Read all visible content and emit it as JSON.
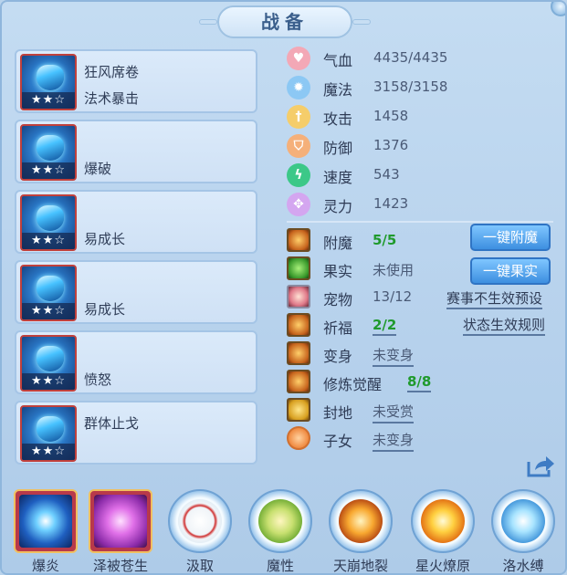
{
  "title": "战备",
  "equipment": [
    {
      "name": "狂风席卷",
      "effect": "法术暴击",
      "stars": "★★☆"
    },
    {
      "name": "",
      "effect": "爆破",
      "stars": "★★☆"
    },
    {
      "name": "",
      "effect": "易成长",
      "stars": "★★☆"
    },
    {
      "name": "",
      "effect": "易成长",
      "stars": "★★☆"
    },
    {
      "name": "",
      "effect": "愤怒",
      "stars": "★★☆"
    },
    {
      "name": "群体止戈",
      "effect": "",
      "stars": "★★☆"
    }
  ],
  "stats": [
    {
      "label": "气血",
      "value": "4435/4435",
      "icon": "heart-icon",
      "color": "#e8647c"
    },
    {
      "label": "魔法",
      "value": "3158/3158",
      "icon": "mana-icon",
      "color": "#4aa8f0"
    },
    {
      "label": "攻击",
      "value": "1458",
      "icon": "sword-icon",
      "color": "#f0b040"
    },
    {
      "label": "防御",
      "value": "1376",
      "icon": "shield-icon",
      "color": "#f0a060"
    },
    {
      "label": "速度",
      "value": "543",
      "icon": "lightning-icon",
      "color": "#28c07a"
    },
    {
      "label": "灵力",
      "value": "1423",
      "icon": "spirit-icon",
      "color": "#c080e8"
    }
  ],
  "info": [
    {
      "label": "附魔",
      "value": "5/5"
    },
    {
      "label": "果实",
      "value": "未使用"
    },
    {
      "label": "宠物",
      "value": "13/12"
    },
    {
      "label": "祈福",
      "value": "2/2"
    },
    {
      "label": "变身",
      "value": "未变身"
    },
    {
      "label": "修炼觉醒",
      "value": "8/8"
    },
    {
      "label": "封地",
      "value": "未受赏"
    },
    {
      "label": "子女",
      "value": "未变身"
    }
  ],
  "buttons": {
    "enchant": "一键附魔",
    "fruit": "一键果实"
  },
  "links": {
    "event_preset": "赛事不生效预设",
    "status_rules": "状态生效规则"
  },
  "skills": [
    {
      "label": "爆炎"
    },
    {
      "label": "泽被苍生"
    },
    {
      "label": "汲取"
    },
    {
      "label": "魔性"
    },
    {
      "label": "天崩地裂"
    },
    {
      "label": "星火燎原"
    },
    {
      "label": "洛水缚"
    }
  ]
}
